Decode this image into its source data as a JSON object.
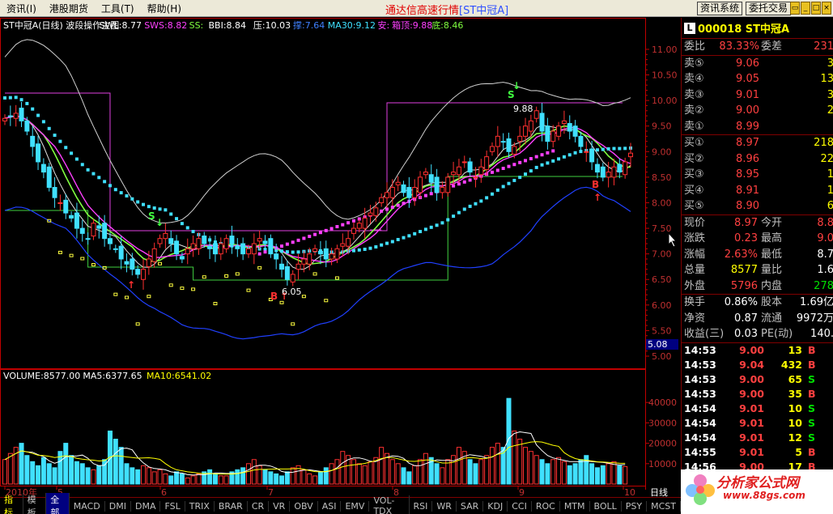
{
  "menu": [
    "资讯(I)",
    "港股期货",
    "工具(T)",
    "帮助(H)"
  ],
  "app_title": "通达信高速行情",
  "app_subtitle": "[ST中冠A]",
  "top_buttons": [
    "资讯系统",
    "委托交易"
  ],
  "indicator_header": {
    "name": "ST中冠A(日线) 波段操作主图",
    "swl": "SWL:8.77",
    "sws": "SWS:8.82",
    "ss": "SS:",
    "bbi": "BBI:8.84",
    "ya": "压:10.03",
    "zhi": "撑:7.64",
    "ma30": "MA30:9.12",
    "an": "安:",
    "box_top": "箱顶:9.88",
    "di": "底:8.46"
  },
  "colors": {
    "up": "#ff3030",
    "down": "#40e0ff",
    "ma_white": "#e0e0e0",
    "ma_green": "#80ff40",
    "ma_pink": "#ff40ff",
    "ma_cyan_dots": "#40e0ff",
    "box_line": "#e040e0",
    "bollinger_lower": "#2040ff",
    "axis": "#c00000"
  },
  "chart_data": [
    {
      "type": "candlestick",
      "title": "ST中冠A(日线) 波段操作主图",
      "ylim": [
        5.0,
        11.3
      ],
      "y_ticks": [
        "11.00",
        "10.50",
        "10.00",
        "9.50",
        "9.00",
        "8.50",
        "8.00",
        "7.50",
        "7.00",
        "6.50",
        "6.00",
        "5.50",
        "5.00"
      ],
      "x_month_labels": [
        "2010年",
        "5",
        "6",
        "7",
        "8",
        "9",
        "10"
      ],
      "current_price_tag": "5.08",
      "annotations": [
        "S",
        "S",
        "B",
        "B",
        "9.88",
        "6.05"
      ],
      "close": [
        9.65,
        9.7,
        9.75,
        9.6,
        9.4,
        9.1,
        8.8,
        8.6,
        8.3,
        8.1,
        8.0,
        7.8,
        7.7,
        7.5,
        7.4,
        7.3,
        7.6,
        7.5,
        7.3,
        7.2,
        7.1,
        6.9,
        6.8,
        6.7,
        6.6,
        6.7,
        6.9,
        7.1,
        7.3,
        7.4,
        7.2,
        7.0,
        6.9,
        7.1,
        7.2,
        7.3,
        7.2,
        7.1,
        7.0,
        7.2,
        7.3,
        7.2,
        7.1,
        7.0,
        7.1,
        7.2,
        7.3,
        7.2,
        7.0,
        6.9,
        6.7,
        6.5,
        6.6,
        6.8,
        6.9,
        7.0,
        7.1,
        7.0,
        6.9,
        7.0,
        7.1,
        7.2,
        7.3,
        7.5,
        7.6,
        7.7,
        7.8,
        7.9,
        8.1,
        8.2,
        8.3,
        8.4,
        8.2,
        8.1,
        8.3,
        8.5,
        8.6,
        8.4,
        8.2,
        8.3,
        8.5,
        8.6,
        8.7,
        8.8,
        8.6,
        8.5,
        8.7,
        8.9,
        9.1,
        9.3,
        9.2,
        9.0,
        9.1,
        9.3,
        9.5,
        9.6,
        9.8,
        9.4,
        9.2,
        9.4,
        9.5,
        9.6,
        9.4,
        9.3,
        9.1,
        9.0,
        8.8,
        8.6,
        8.5,
        8.6,
        8.7,
        8.6,
        8.8,
        8.97
      ],
      "volume": [
        12000,
        15000,
        18000,
        20000,
        14000,
        11000,
        9000,
        13000,
        10000,
        8000,
        16000,
        20000,
        14000,
        11000,
        10000,
        8000,
        7000,
        9000,
        12000,
        26000,
        22000,
        18000,
        10000,
        8000,
        7000,
        9000,
        8000,
        6000,
        7000,
        5000,
        4000,
        6000,
        5000,
        3000,
        4000,
        5000,
        6000,
        7000,
        5000,
        4000,
        4000,
        6000,
        7000,
        8000,
        10000,
        12000,
        9000,
        7000,
        6000,
        5000,
        4000,
        6000,
        8000,
        9000,
        7000,
        5000,
        4000,
        6000,
        8000,
        10000,
        12000,
        16000,
        14000,
        12000,
        10000,
        9000,
        11000,
        13000,
        18000,
        15000,
        12000,
        10000,
        8000,
        6000,
        9000,
        12000,
        15000,
        13000,
        10000,
        8000,
        12000,
        14000,
        18000,
        16000,
        12000,
        10000,
        12000,
        14000,
        18000,
        20000,
        18000,
        42000,
        26000,
        22000,
        18000,
        16000,
        14000,
        12000,
        10000,
        12000,
        13000,
        11000,
        9000,
        10000,
        12000,
        14000,
        10000,
        8000,
        9000,
        10000,
        11000,
        9000,
        8577
      ]
    },
    {
      "type": "bar",
      "title": "VOLUME",
      "ylim": [
        0,
        50000
      ],
      "y_ticks": [
        "40000",
        "30000",
        "20000",
        "10000"
      ]
    }
  ],
  "volume_header": {
    "volume": "VOLUME:8577.00",
    "ma5": "MA5:6377.65",
    "ma10": "MA10:6541.02"
  },
  "quote": {
    "code_badge": "L",
    "code": "000018 ST中冠A",
    "weibi_label": "委比",
    "weibi": "83.33%",
    "weicha_label": "委差",
    "weicha": "231",
    "asks": [
      {
        "label": "卖⑤",
        "price": "9.06",
        "vol": "3"
      },
      {
        "label": "卖④",
        "price": "9.05",
        "vol": "13"
      },
      {
        "label": "卖③",
        "price": "9.01",
        "vol": "3"
      },
      {
        "label": "卖②",
        "price": "9.00",
        "vol": "2"
      },
      {
        "label": "卖①",
        "price": "8.99",
        "vol": ""
      }
    ],
    "bids": [
      {
        "label": "买①",
        "price": "8.97",
        "vol": "218"
      },
      {
        "label": "买②",
        "price": "8.96",
        "vol": "22"
      },
      {
        "label": "买③",
        "price": "8.95",
        "vol": "1"
      },
      {
        "label": "买④",
        "price": "8.91",
        "vol": "1"
      },
      {
        "label": "买⑤",
        "price": "8.90",
        "vol": "6"
      }
    ],
    "stats": [
      {
        "l1": "现价",
        "v1": "8.97",
        "c1": "red",
        "l2": "今开",
        "v2": "8.8",
        "c2": "red"
      },
      {
        "l1": "涨跌",
        "v1": "0.23",
        "c1": "red",
        "l2": "最高",
        "v2": "9.0",
        "c2": "red"
      },
      {
        "l1": "涨幅",
        "v1": "2.63%",
        "c1": "red",
        "l2": "最低",
        "v2": "8.7",
        "c2": "white"
      },
      {
        "l1": "总量",
        "v1": "8577",
        "c1": "yellow",
        "l2": "量比",
        "v2": "1.6",
        "c2": "white"
      },
      {
        "l1": "外盘",
        "v1": "5796",
        "c1": "red",
        "l2": "内盘",
        "v2": "278",
        "c2": "green"
      }
    ],
    "stats2": [
      {
        "l1": "换手",
        "v1": "0.86%",
        "c1": "white",
        "l2": "股本",
        "v2": "1.69亿",
        "c2": "white"
      },
      {
        "l1": "净资",
        "v1": "0.87",
        "c1": "white",
        "l2": "流通",
        "v2": "9972万",
        "c2": "white"
      },
      {
        "l1": "收益(三)",
        "v1": "0.03",
        "c1": "white",
        "l2": "PE(动)",
        "v2": "140.",
        "c2": "white"
      }
    ],
    "ticks": [
      {
        "t": "14:53",
        "p": "9.00",
        "v": "13",
        "d": "B",
        "dc": "red"
      },
      {
        "t": "14:53",
        "p": "9.04",
        "v": "432",
        "d": "B",
        "dc": "red"
      },
      {
        "t": "14:53",
        "p": "9.00",
        "v": "65",
        "d": "S",
        "dc": "green"
      },
      {
        "t": "14:53",
        "p": "9.00",
        "v": "35",
        "d": "B",
        "dc": "red"
      },
      {
        "t": "14:54",
        "p": "9.01",
        "v": "10",
        "d": "S",
        "dc": "green"
      },
      {
        "t": "14:54",
        "p": "9.01",
        "v": "10",
        "d": "S",
        "dc": "green"
      },
      {
        "t": "14:54",
        "p": "9.01",
        "v": "12",
        "d": "S",
        "dc": "green"
      },
      {
        "t": "14:55",
        "p": "9.01",
        "v": "5",
        "d": "B",
        "dc": "red"
      },
      {
        "t": "14:56",
        "p": "9.00",
        "v": "17",
        "d": "B",
        "dc": "red"
      }
    ]
  },
  "bottom_tabs": [
    "指标",
    "模板",
    "全部",
    "MACD",
    "DMI",
    "DMA",
    "FSL",
    "TRIX",
    "BRAR",
    "CR",
    "VR",
    "OBV",
    "ASI",
    "EMV",
    "VOL-TDX",
    "RSI",
    "WR",
    "SAR",
    "KDJ",
    "CCI",
    "ROC",
    "MTM",
    "BOLL",
    "PSY",
    "MCST"
  ],
  "period_label": "日线",
  "watermark": {
    "title": "分析家公式网",
    "url": "www.88gs.com"
  }
}
